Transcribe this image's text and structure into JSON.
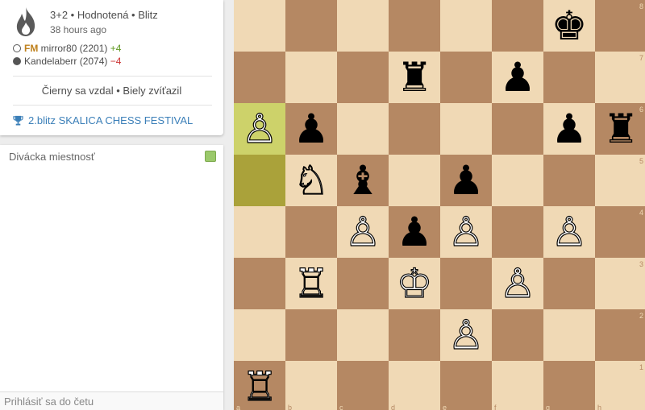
{
  "game": {
    "type": "3+2 • Hodnotená • Blitz",
    "time_ago": "38 hours ago",
    "white": {
      "title": "FM",
      "name": "mirror80 (2201)",
      "rating_diff": "+4"
    },
    "black": {
      "name": "Kandelaberr (2074)",
      "rating_diff": "−4"
    },
    "result": "Čierny sa vzdal • Biely zvíťazil",
    "tournament": "2.blitz SKALICA CHESS FESTIVAL"
  },
  "chat": {
    "title": "Divácka miestnosť",
    "placeholder": "Prihlásiť sa do četu"
  },
  "board": {
    "light_color": "#f0d9b5",
    "dark_color": "#b58863",
    "highlight_light": "#cdd26a",
    "highlight_dark": "#aaa23a",
    "files": [
      "a",
      "b",
      "c",
      "d",
      "e",
      "f",
      "g",
      "h"
    ],
    "ranks": [
      "8",
      "7",
      "6",
      "5",
      "4",
      "3",
      "2",
      "1"
    ],
    "last_move": [
      "a5",
      "a6"
    ],
    "pieces": [
      {
        "square": "g8",
        "piece": "king",
        "color": "black"
      },
      {
        "square": "d7",
        "piece": "rook",
        "color": "black"
      },
      {
        "square": "f7",
        "piece": "pawn",
        "color": "black"
      },
      {
        "square": "a6",
        "piece": "pawn",
        "color": "white"
      },
      {
        "square": "b6",
        "piece": "pawn",
        "color": "black"
      },
      {
        "square": "g6",
        "piece": "pawn",
        "color": "black"
      },
      {
        "square": "h6",
        "piece": "rook",
        "color": "black"
      },
      {
        "square": "b5",
        "piece": "knight",
        "color": "white"
      },
      {
        "square": "c5",
        "piece": "bishop",
        "color": "black"
      },
      {
        "square": "e5",
        "piece": "pawn",
        "color": "black"
      },
      {
        "square": "c4",
        "piece": "pawn",
        "color": "white"
      },
      {
        "square": "d4",
        "piece": "pawn",
        "color": "black"
      },
      {
        "square": "e4",
        "piece": "pawn",
        "color": "white"
      },
      {
        "square": "g4",
        "piece": "pawn",
        "color": "white"
      },
      {
        "square": "b3",
        "piece": "rook",
        "color": "white"
      },
      {
        "square": "d3",
        "piece": "king",
        "color": "white"
      },
      {
        "square": "f3",
        "piece": "pawn",
        "color": "white"
      },
      {
        "square": "e2",
        "piece": "pawn",
        "color": "white"
      },
      {
        "square": "a1",
        "piece": "rook",
        "color": "white"
      }
    ]
  }
}
